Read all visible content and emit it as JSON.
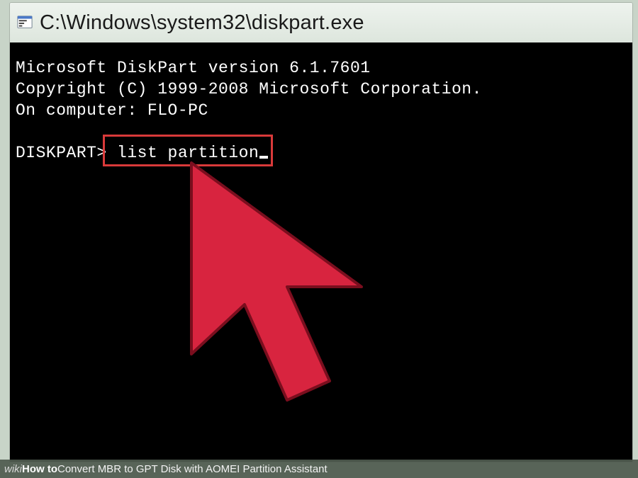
{
  "window": {
    "title": "C:\\Windows\\system32\\diskpart.exe"
  },
  "terminal": {
    "line1": "Microsoft DiskPart version 6.1.7601",
    "line2": "Copyright (C) 1999-2008 Microsoft Corporation.",
    "line3": "On computer: FLO-PC",
    "prompt": "DISKPART>",
    "command": "list partition"
  },
  "highlight": {
    "target": "list partition"
  },
  "caption": {
    "brand_prefix": "wiki",
    "brand_suffix": "How to",
    "article": " Convert MBR to GPT Disk with AOMEI Partition Assistant"
  }
}
